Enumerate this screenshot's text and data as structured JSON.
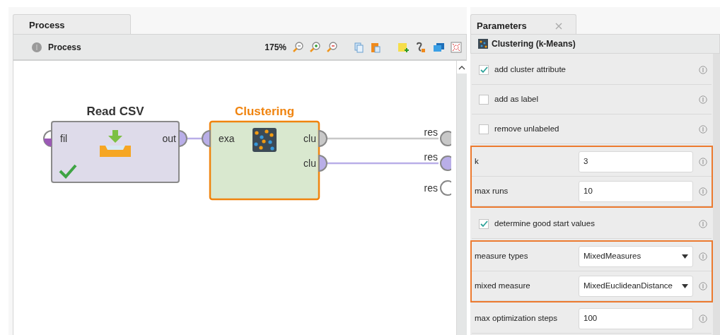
{
  "process_panel": {
    "tab": {
      "label": "Process",
      "selected": true
    },
    "breadcrumb": "Process",
    "zoom": "175%"
  },
  "operators": [
    {
      "title": "Read CSV",
      "kind": "read",
      "selected": false,
      "color": "#dedbea",
      "status_ok": true,
      "ports_in": [
        {
          "label": "fil",
          "color": "#9b59b6",
          "partial": true
        }
      ],
      "ports_out": [
        {
          "label": "out",
          "color": "#b9aee8",
          "connected": true
        }
      ]
    },
    {
      "title": "Clustering",
      "kind": "clustering",
      "selected": true,
      "color": "#d9e8cf",
      "status_ok": false,
      "ports_in": [
        {
          "label": "exa",
          "color": "#b9aee8",
          "partial": false
        }
      ],
      "ports_out": [
        {
          "label": "clu",
          "color": "#c8c8c8",
          "connected": true
        },
        {
          "label": "clu",
          "color": "#b9aee8",
          "connected": true
        }
      ]
    }
  ],
  "result_ports": [
    {
      "label": "res"
    },
    {
      "label": "res"
    },
    {
      "label": "res"
    }
  ],
  "parameters_panel": {
    "tab": {
      "label": "Parameters",
      "selected": true,
      "closable": true
    },
    "operator": "Clustering (k-Means)",
    "groups": [
      {
        "highlighted": false,
        "params": [
          {
            "kind": "checkbox",
            "label": "add cluster attribute",
            "checked": true
          },
          {
            "kind": "checkbox",
            "label": "add as label",
            "checked": false
          },
          {
            "kind": "checkbox",
            "label": "remove unlabeled",
            "checked": false
          }
        ]
      },
      {
        "highlighted": true,
        "params": [
          {
            "kind": "text",
            "label": "k",
            "value": "3"
          },
          {
            "kind": "text",
            "label": "max runs",
            "value": "10"
          }
        ]
      },
      {
        "highlighted": false,
        "params": [
          {
            "kind": "checkbox",
            "label": "determine good start values",
            "checked": true
          }
        ]
      },
      {
        "highlighted": true,
        "params": [
          {
            "kind": "select",
            "label": "measure types",
            "value": "MixedMeasures"
          },
          {
            "kind": "select",
            "label": "mixed measure",
            "value": "MixedEuclideanDistance"
          }
        ]
      },
      {
        "highlighted": false,
        "params": [
          {
            "kind": "text",
            "label": "max optimization steps",
            "value": "100"
          }
        ]
      }
    ]
  }
}
